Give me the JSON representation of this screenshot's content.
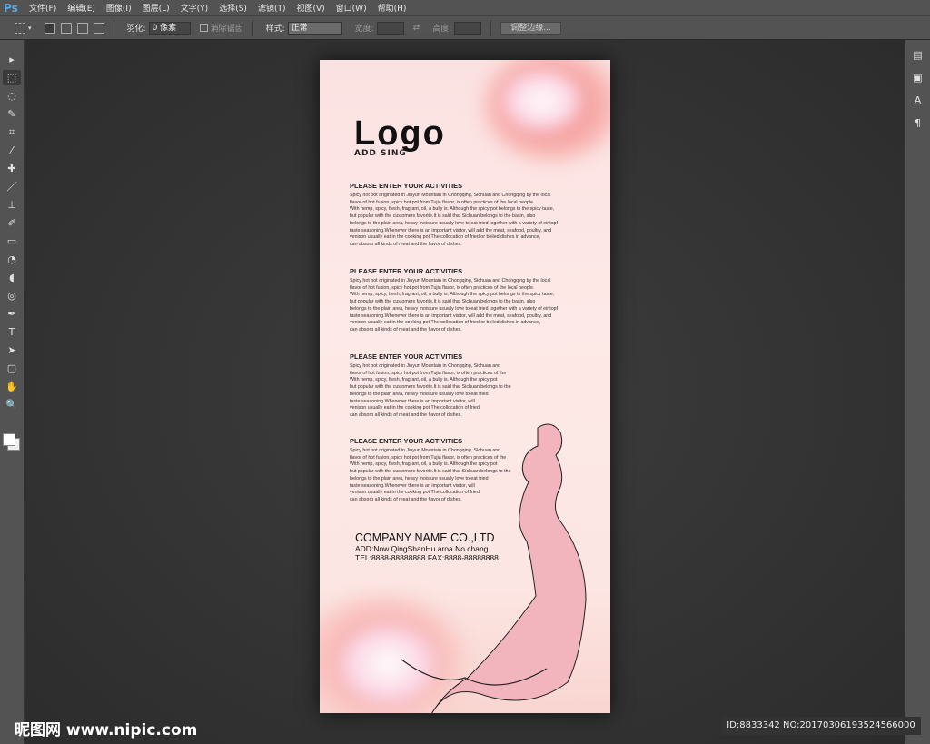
{
  "app": {
    "logo": "Ps"
  },
  "menu": [
    "文件(F)",
    "编辑(E)",
    "图像(I)",
    "图层(L)",
    "文字(Y)",
    "选择(S)",
    "滤镜(T)",
    "视图(V)",
    "窗口(W)",
    "帮助(H)"
  ],
  "options": {
    "feather_label": "羽化:",
    "feather_value": "0 像素",
    "antialias_label": "消除锯齿",
    "style_label": "样式:",
    "style_value": "正常",
    "width_label": "宽度:",
    "height_label": "高度:",
    "refine_edge": "调整边缘..."
  },
  "tools": [
    "move-tool",
    "marquee-tool",
    "lasso-tool",
    "quick-select-tool",
    "crop-tool",
    "eyedropper-tool",
    "healing-tool",
    "brush-tool",
    "stamp-tool",
    "history-brush-tool",
    "eraser-tool",
    "paint-bucket-tool",
    "blur-tool",
    "dodge-tool",
    "pen-tool",
    "type-tool",
    "path-select-tool",
    "shape-tool",
    "hand-tool",
    "zoom-tool"
  ],
  "poster": {
    "logo": "Logo",
    "logo_sub": "ADD SING",
    "sections": [
      {
        "title": "PLEASE ENTER YOUR ACTIVITIES",
        "lines": [
          "Spicy hot pot originated in Jinyun Mountain in Chongqing, Sichuan and Chongqing by the local",
          "flavor of hot fusion, spicy hot pot from Tujia flavor, is often practices of the local people.",
          "With hemp, spicy, fresh, fragrant, oil, a bully is. Although the spicy pot belongs to the spicy taste,",
          "but popular with the customers favorite.It is said that Sichuan belongs to the basin, also",
          "belongs to the plain area, heavy moisture usually love to eat fried together with a variety of eintopf",
          "taste seasoning.Whenever there is an important visitor, will add the meat, seafood, poultry, and",
          "venison usually eat in the cooking pot,The collocation of fried or boiled dishes in advance,",
          "can absorb all kinds of meat and the flavor of dishes."
        ]
      },
      {
        "title": "PLEASE ENTER YOUR ACTIVITIES",
        "lines": [
          "Spicy hot pot originated in Jinyun Mountain in Chongqing, Sichuan and Chongqing by the local",
          "flavor of hot fusion, spicy hot pot from Tujia flavor, is often practices of the local people.",
          "With hemp, spicy, fresh, fragrant, oil, a bully is. Although the spicy pot belongs to the spicy taste,",
          "but popular with the customers favorite.It is said that Sichuan belongs to the basin, also",
          "belongs to the plain area, heavy moisture usually love to eat fried together with a variety of eintopf",
          "taste seasoning.Whenever there is an important visitor, will add the meat, seafood, poultry, and",
          "venison usually eat in the cooking pot,The collocation of fried or boiled dishes in advance,",
          "can absorb all kinds of meat and the flavor of dishes."
        ]
      },
      {
        "title": "PLEASE ENTER YOUR ACTIVITIES",
        "lines": [
          "Spicy hot pot originated in Jinyun Mountain in Chongqing, Sichuan and",
          "flavor of hot fusion, spicy hot pot from Tujia flavor, is often practices of the",
          "With hemp, spicy, fresh, fragrant, oil, a bully is. Although the spicy pot",
          "but popular with the customers favorite.It is said that Sichuan belongs to the",
          "belongs to the plain area, heavy moisture usually love to eat fried",
          "taste seasoning.Whenever there is an important visitor, will",
          "venison usually eat in the cooking pot,The collocation of fried",
          "can absorb all kinds of meat and the flavor of dishes."
        ]
      },
      {
        "title": "PLEASE ENTER YOUR ACTIVITIES",
        "lines": [
          "Spicy hot pot originated in Jinyun Mountain in Chongqing, Sichuan and",
          "flavor of hot fusion, spicy hot pot from Tujia flavor, is often practices of the",
          "With hemp, spicy, fresh, fragrant, oil, a bully is. Although the spicy pot",
          "but popular with the customers favorite.It is said that Sichuan belongs to the",
          "belongs to the plain area, heavy moisture usually love to eat fried",
          "taste seasoning.Whenever there is an important visitor, will",
          "venison usually eat in the cooking pot,The collocation of fried",
          "can absorb all kinds of meat and the flavor of dishes."
        ]
      }
    ],
    "company": "COMPANY NAME CO.,LTD",
    "address": "ADD:Now QingShanHu aroa.No.chang",
    "phone": "TEL:8888-88888888  FAX:8888-88888888"
  },
  "watermark": {
    "site": "昵图网 www.nipic.com",
    "id": "ID:8833342 NO:20170306193524566000"
  }
}
